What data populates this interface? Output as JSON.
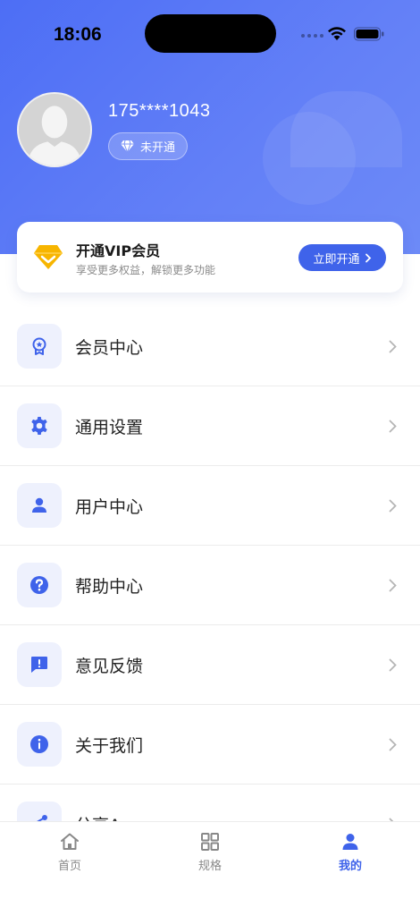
{
  "status_bar": {
    "time": "18:06"
  },
  "profile": {
    "phone": "175****1043",
    "membership_status": "未开通"
  },
  "vip_card": {
    "title": "开通VIP会员",
    "subtitle": "享受更多权益，解锁更多功能",
    "button_label": "立即开通"
  },
  "menu": {
    "items": [
      {
        "label": "会员中心",
        "icon": "badge-icon"
      },
      {
        "label": "通用设置",
        "icon": "gear-icon"
      },
      {
        "label": "用户中心",
        "icon": "user-icon"
      },
      {
        "label": "帮助中心",
        "icon": "help-icon"
      },
      {
        "label": "意见反馈",
        "icon": "feedback-icon"
      },
      {
        "label": "关于我们",
        "icon": "info-icon"
      },
      {
        "label": "分享App",
        "icon": "share-icon"
      }
    ]
  },
  "tab_bar": {
    "tabs": [
      {
        "label": "首页",
        "icon": "home-icon"
      },
      {
        "label": "规格",
        "icon": "grid-icon"
      },
      {
        "label": "我的",
        "icon": "person-icon",
        "active": true
      }
    ]
  },
  "colors": {
    "primary": "#3f63ea",
    "header_gradient_start": "#4d6ef5",
    "vip_gold": "#f7b500",
    "icon_bg": "#eef1fd"
  }
}
